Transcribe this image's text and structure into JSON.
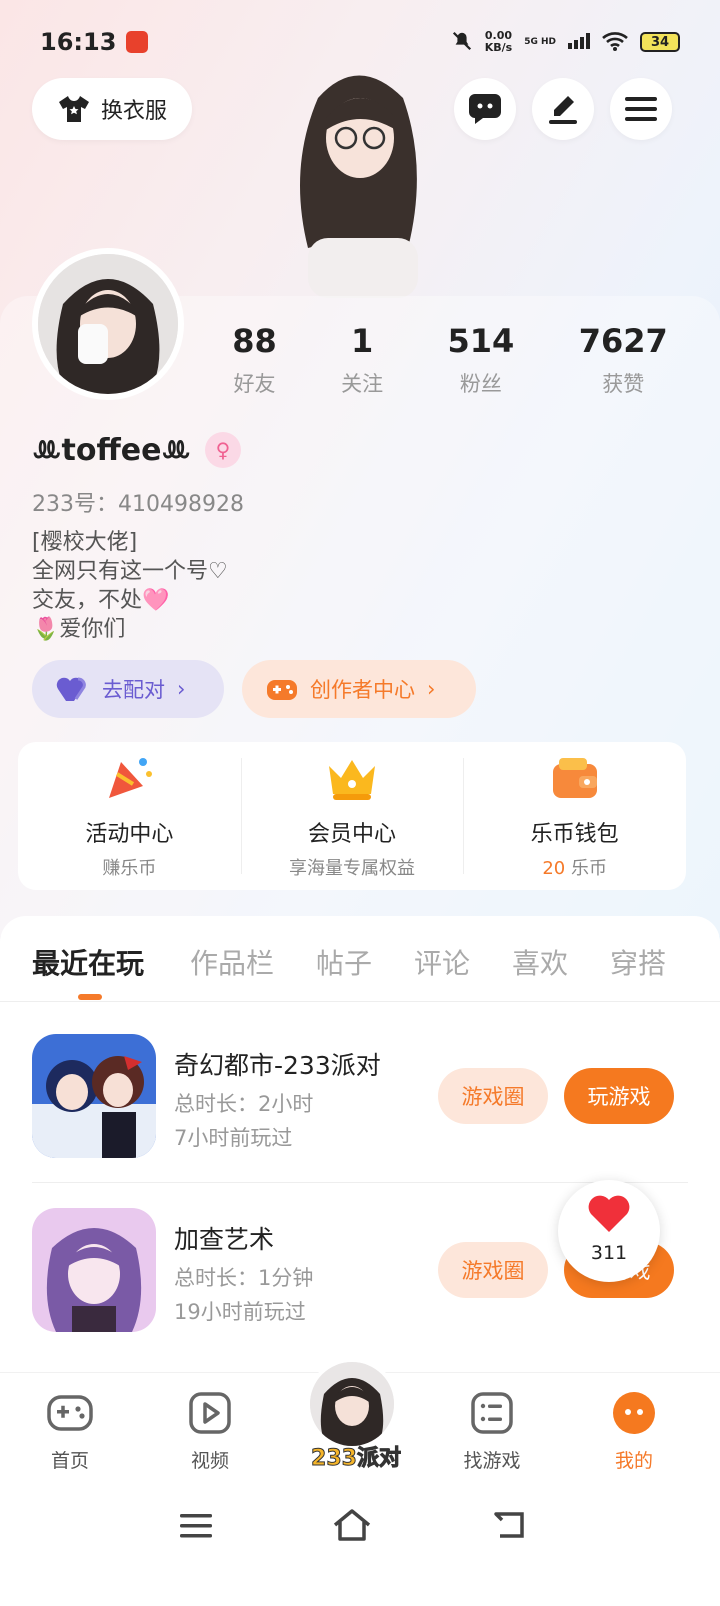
{
  "status_bar": {
    "time": "16:13",
    "net_speed_value": "0.00",
    "net_speed_unit": "KB/s",
    "network": "5G HD",
    "battery": "34"
  },
  "header": {
    "outfit_label": "换衣服"
  },
  "stats": [
    {
      "num": "88",
      "label": "好友"
    },
    {
      "num": "1",
      "label": "关注"
    },
    {
      "num": "514",
      "label": "粉丝"
    },
    {
      "num": "7627",
      "label": "获赞"
    }
  ],
  "profile": {
    "nickname": "ꔛtoffeeꔛ",
    "uid": "233号：410498928",
    "bio": [
      "[樱校大佬]",
      "全网只有这一个号♡",
      "交友，不处🩷",
      "🌷爱你们"
    ]
  },
  "pills": {
    "pair": "去配对",
    "creator": "创作者中心"
  },
  "quick": [
    {
      "title": "活动中心",
      "sub": "赚乐币"
    },
    {
      "title": "会员中心",
      "sub": "享海量专属权益"
    },
    {
      "title": "乐币钱包",
      "amount": "20",
      "unit": "乐币"
    }
  ],
  "tabs": [
    "最近在玩",
    "作品栏",
    "帖子",
    "评论",
    "喜欢",
    "穿搭"
  ],
  "games": [
    {
      "name": "奇幻都市-233派对",
      "duration": "总时长：2小时",
      "last": "7小时前玩过",
      "circle": "游戏圈",
      "play": "玩游戏"
    },
    {
      "name": "加查艺术",
      "duration": "总时长：1分钟",
      "last": "19小时前玩过",
      "circle": "游戏圈",
      "play": "玩游戏"
    }
  ],
  "like_count": "311",
  "bottom_nav": {
    "home": "首页",
    "video": "视频",
    "center": "233派对",
    "find": "找游戏",
    "mine": "我的"
  },
  "colors": {
    "accent": "#f57a2a",
    "pair": "#6a5cd1"
  }
}
